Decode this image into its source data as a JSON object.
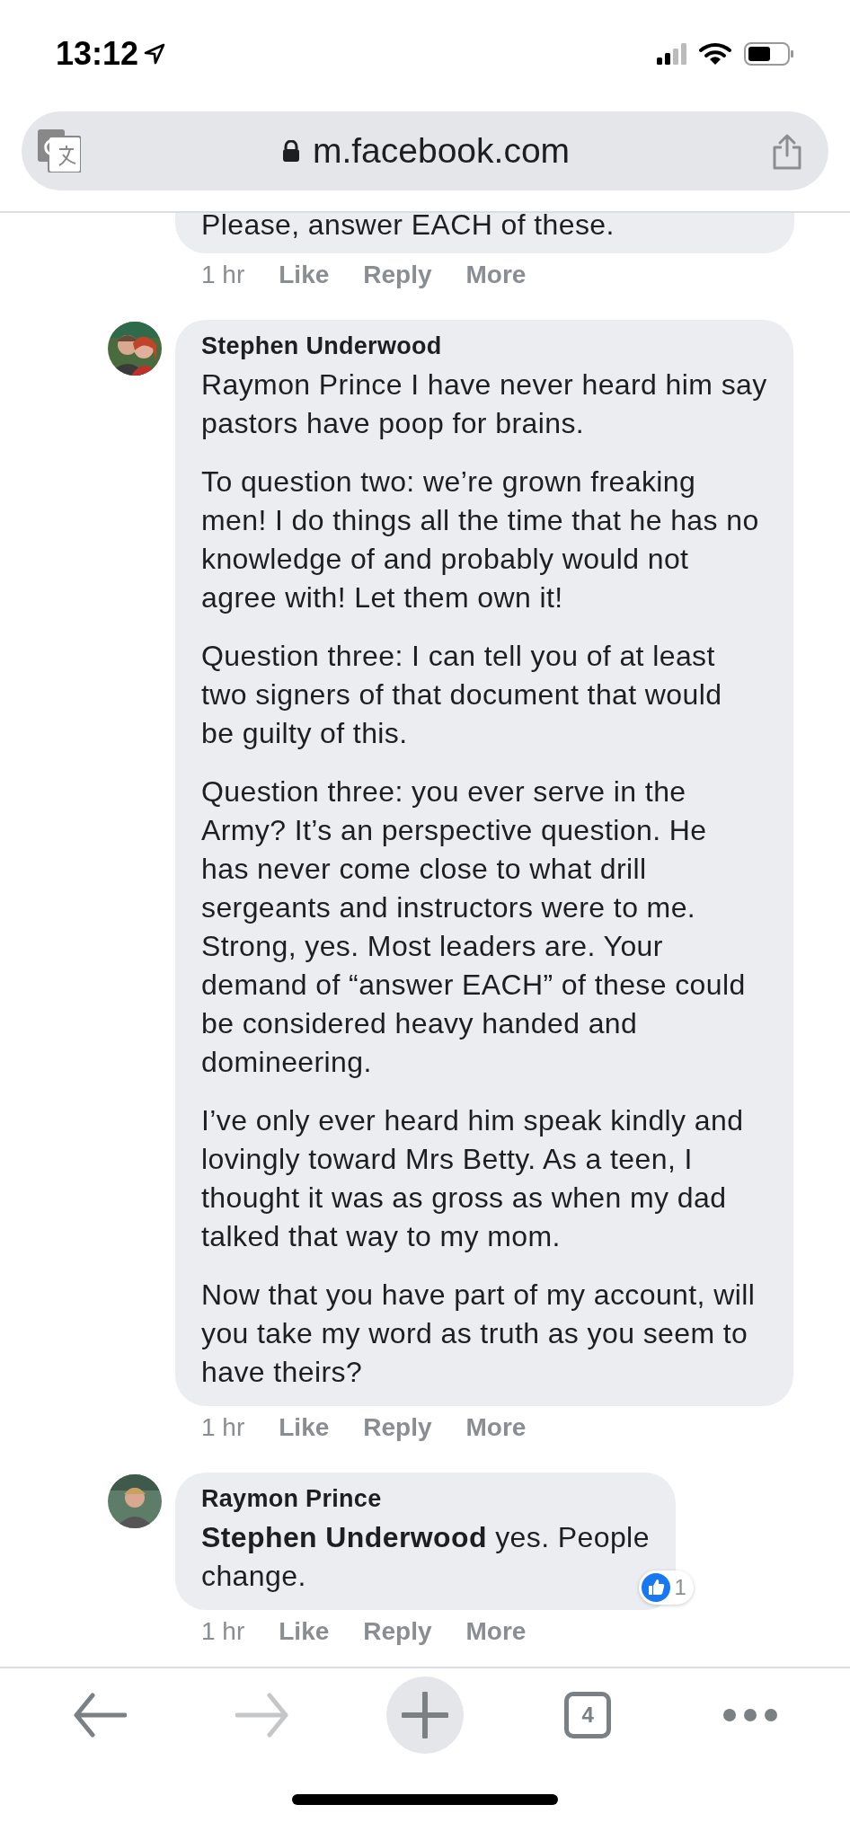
{
  "status_bar": {
    "time": "13:12"
  },
  "address_bar": {
    "url": "m.facebook.com"
  },
  "comments": [
    {
      "kind": "clipped",
      "body": [
        "Please, answer EACH of these."
      ],
      "time": "1 hr",
      "actions": [
        "Like",
        "Reply",
        "More"
      ]
    },
    {
      "kind": "full",
      "author": "Stephen Underwood",
      "body": [
        "Raymon Prince I have never heard him say\npastors have poop for brains.",
        "To question two: we’re grown freaking\nmen! I do things all the time that he has no\nknowledge of and probably would not\nagree with! Let them own it!",
        "Question three: I can tell you of at least\ntwo signers of that document that would\nbe guilty of this.",
        "Question three: you ever serve in the\nArmy? It’s an perspective question. He\nhas never come close to what drill\nsergeants and instructors were to me.\nStrong, yes. Most leaders are. Your\ndemand of “answer EACH” of these could\nbe considered heavy handed and\ndomineering.",
        "I’ve only ever heard him speak kindly and\nlovingly toward Mrs Betty. As a teen, I\nthought it was as gross as when my dad\ntalked that way to my mom.",
        "Now that you have part of my account, will\nyou take my word as truth as you seem to\nhave theirs?"
      ],
      "time": "1 hr",
      "actions": [
        "Like",
        "Reply",
        "More"
      ]
    },
    {
      "kind": "full",
      "author": "Raymon Prince",
      "body": [
        "**Stephen Underwood** yes. People\nchange."
      ],
      "reaction_count": "1",
      "time": "1 hr",
      "actions": [
        "Like",
        "Reply",
        "More"
      ]
    }
  ],
  "toolbar": {
    "buttons": [
      {
        "kind": "back",
        "disabled": false
      },
      {
        "kind": "forward",
        "disabled": true
      },
      {
        "kind": "new_tab",
        "disabled": false
      },
      {
        "kind": "tabs",
        "label": "4",
        "disabled": false
      },
      {
        "kind": "more",
        "disabled": false
      }
    ]
  }
}
